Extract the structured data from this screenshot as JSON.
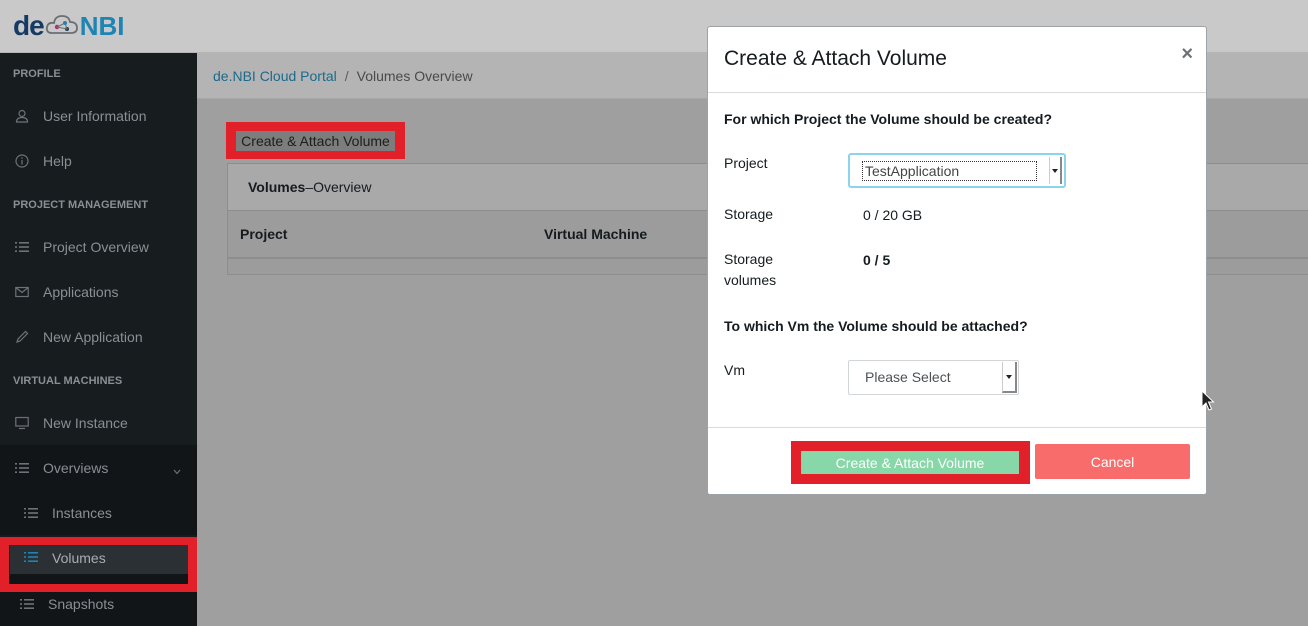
{
  "logo": {
    "part1": "de",
    "part2": "NBI"
  },
  "sidebar": {
    "sections": {
      "profile": "PROFILE",
      "project_management": "PROJECT MANAGEMENT",
      "virtual_machines": "VIRTUAL MACHINES"
    },
    "items": {
      "user_information": "User Information",
      "help": "Help",
      "project_overview": "Project Overview",
      "applications": "Applications",
      "new_application": "New Application",
      "new_instance": "New Instance",
      "overviews": "Overviews",
      "instances": "Instances",
      "volumes": "Volumes",
      "snapshots": "Snapshots"
    }
  },
  "breadcrumb": {
    "home": "de.NBI Cloud Portal",
    "separator": "/",
    "current": "Volumes Overview"
  },
  "main": {
    "create_button": "Create & Attach Volume",
    "card_title_bold": "Volumes",
    "card_title_rest": " –Overview",
    "columns": [
      "Project",
      "Virtual Machine"
    ]
  },
  "modal": {
    "title": "Create & Attach Volume",
    "close": "×",
    "question_project": "For which Project the Volume should be created?",
    "project_label": "Project",
    "project_value": "TestApplication",
    "storage_label": "Storage",
    "storage_value": "0 / 20 GB",
    "volumes_label_1": "Storage",
    "volumes_label_2": "volumes",
    "volumes_value": "0 / 5",
    "question_vm": "To which Vm the Volume should be attached?",
    "vm_label": "Vm",
    "vm_placeholder": "Please Select",
    "submit": "Create & Attach Volume",
    "cancel": "Cancel"
  },
  "colors": {
    "accent_red": "#e2202a",
    "success": "#87d7a8",
    "danger": "#f86c6b",
    "link": "#1b6a8d"
  }
}
